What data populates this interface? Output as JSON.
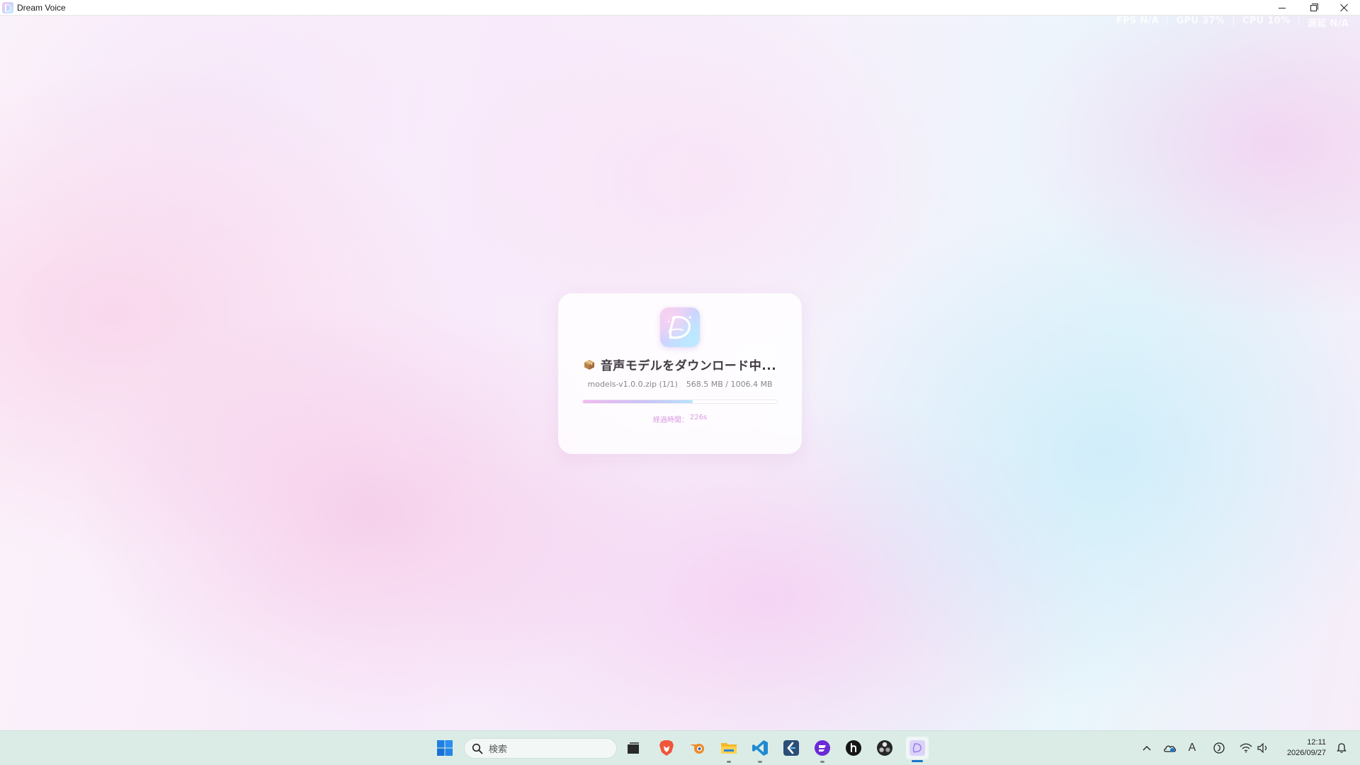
{
  "window": {
    "title": "Dream Voice",
    "controls": [
      "minimize",
      "restore",
      "close"
    ]
  },
  "perf_overlay": {
    "fps": "FPS N/A",
    "gpu": "GPU 37%",
    "cpu": "CPU 10%",
    "mem": "遅延 N/A",
    "separator": "|"
  },
  "download": {
    "icon": "package-icon",
    "title": "音声モデルをダウンロード中...",
    "file_name": "models-v1.0.0.zip (1/1)",
    "size_progress": "568.5 MB / 1006.4 MB",
    "progress_fraction": 0.565,
    "elapsed_label": "経過時間：",
    "elapsed_value": "226s",
    "colors": {
      "progress_start": "#f2b8ef",
      "progress_end": "#b6e3fb",
      "elapsed_text": "#d79be0"
    }
  },
  "taskbar": {
    "search_placeholder": "検索",
    "apps": [
      "windows-start-icon",
      "task-view-icon",
      "brave-browser-icon",
      "blender-icon",
      "file-explorer-icon",
      "vscode-icon",
      "app-k-icon",
      "app-purple-icon",
      "app-black-circle-icon",
      "obs-icon",
      "dream-voice-icon"
    ],
    "tray": [
      "chevron-up-icon",
      "onedrive-icon",
      "ime-a-icon",
      "app-crescent-icon",
      "wifi-icon",
      "volume-icon",
      "notification-icon"
    ],
    "ime": "A",
    "time": "12:11",
    "date": "2026/09/27",
    "accent": "#1a73c9"
  }
}
